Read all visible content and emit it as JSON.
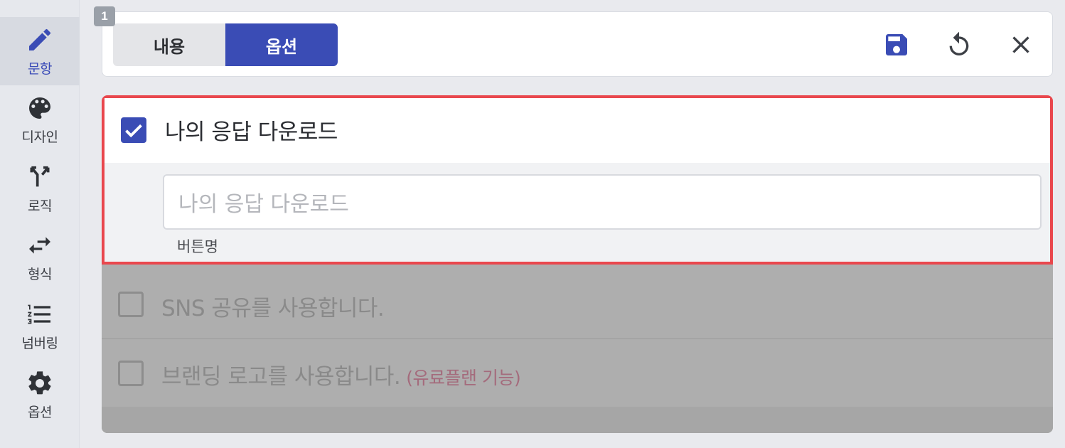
{
  "sidebar": {
    "items": [
      {
        "label": "문항",
        "icon": "pencil-icon",
        "active": true
      },
      {
        "label": "디자인",
        "icon": "palette-icon",
        "active": false
      },
      {
        "label": "로직",
        "icon": "logic-branch-icon",
        "active": false
      },
      {
        "label": "형식",
        "icon": "swap-arrows-icon",
        "active": false
      },
      {
        "label": "넘버링",
        "icon": "numbered-list-icon",
        "active": false
      },
      {
        "label": "옵션",
        "icon": "gear-icon",
        "active": false
      }
    ]
  },
  "question": {
    "number": "1",
    "tabs": [
      {
        "label": "내용",
        "active": false
      },
      {
        "label": "옵션",
        "active": true
      }
    ],
    "toolbar": {
      "save_icon": "save-icon",
      "reset_icon": "undo-icon",
      "close_icon": "close-icon"
    }
  },
  "options": {
    "download": {
      "label": "나의 응답 다운로드",
      "checked": true,
      "input_placeholder": "나의 응답 다운로드",
      "helper": "버튼명"
    },
    "sns_share": {
      "label": "SNS 공유를 사용합니다.",
      "checked": false
    },
    "branding": {
      "label": "브랜딩 로고를 사용합니다.",
      "note": "(유료플랜 기능)",
      "checked": false
    }
  },
  "colors": {
    "accent": "#3a4cb5",
    "highlight_border": "#e9474d",
    "overlay": "#aeaeae"
  }
}
